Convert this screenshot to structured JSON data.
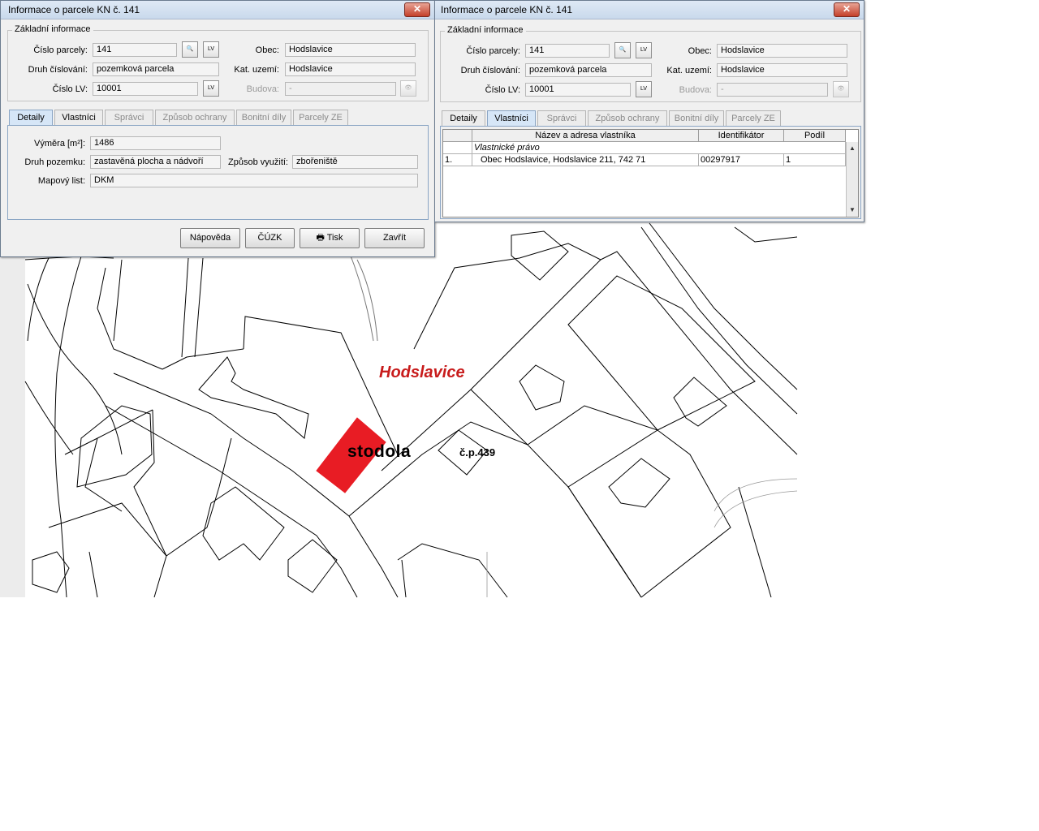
{
  "map": {
    "village_label": "Hodslavice",
    "barn_label": "stodola",
    "house_label": "č.p.439",
    "village_label_color": "#c81c1c",
    "parcel_highlight_color": "#e81c24"
  },
  "dialog1": {
    "title": "Informace o parcele KN č. 141",
    "close_icon": "close-icon",
    "basic_group_title": "Základní informace",
    "parcel_number_label": "Číslo parcely:",
    "parcel_number_value": "141",
    "numbering_type_label": "Druh číslování:",
    "numbering_type_value": "pozemková parcela",
    "lv_number_label": "Číslo LV:",
    "lv_number_value": "10001",
    "municipality_label": "Obec:",
    "municipality_value": "Hodslavice",
    "cadastral_area_label": "Kat. uzemí:",
    "cadastral_area_value": "Hodslavice",
    "building_label": "Budova:",
    "building_value": "-",
    "lv_button_text": "LV",
    "tabs": [
      "Detaily",
      "Vlastníci",
      "Správci",
      "Způsob ochrany",
      "Bonitní díly",
      "Parcely ZE"
    ],
    "details": {
      "area_label": "Výměra [m²]:",
      "area_value": "1486",
      "land_type_label": "Druh pozemku:",
      "land_type_value": "zastavěná plocha a nádvoří",
      "usage_label": "Způsob využití:",
      "usage_value": "zbořeniště",
      "map_sheet_label": "Mapový list:",
      "map_sheet_value": "DKM"
    },
    "buttons": {
      "help": "Nápověda",
      "cuzk": "ČÚZK",
      "print": "Tisk",
      "close": "Zavřít"
    }
  },
  "dialog2": {
    "title": "Informace o parcele KN č. 141",
    "basic_group_title": "Základní informace",
    "parcel_number_label": "Číslo parcely:",
    "parcel_number_value": "141",
    "numbering_type_label": "Druh číslování:",
    "numbering_type_value": "pozemková parcela",
    "lv_number_label": "Číslo LV:",
    "lv_number_value": "10001",
    "municipality_label": "Obec:",
    "municipality_value": "Hodslavice",
    "cadastral_area_label": "Kat. uzemí:",
    "cadastral_area_value": "Hodslavice",
    "building_label": "Budova:",
    "building_value": "-",
    "lv_button_text": "LV",
    "tabs": [
      "Detaily",
      "Vlastníci",
      "Správci",
      "Způsob ochrany",
      "Bonitní díly",
      "Parcely ZE"
    ],
    "owners_table": {
      "columns": [
        "",
        "Název a adresa vlastníka",
        "Identifikátor",
        "Podíl"
      ],
      "group_row": "Vlastnické právo",
      "rows": [
        {
          "index": "1.",
          "name": "Obec Hodslavice, Hodslavice 211, 742 71",
          "id": "00297917",
          "share": "1"
        }
      ]
    }
  }
}
